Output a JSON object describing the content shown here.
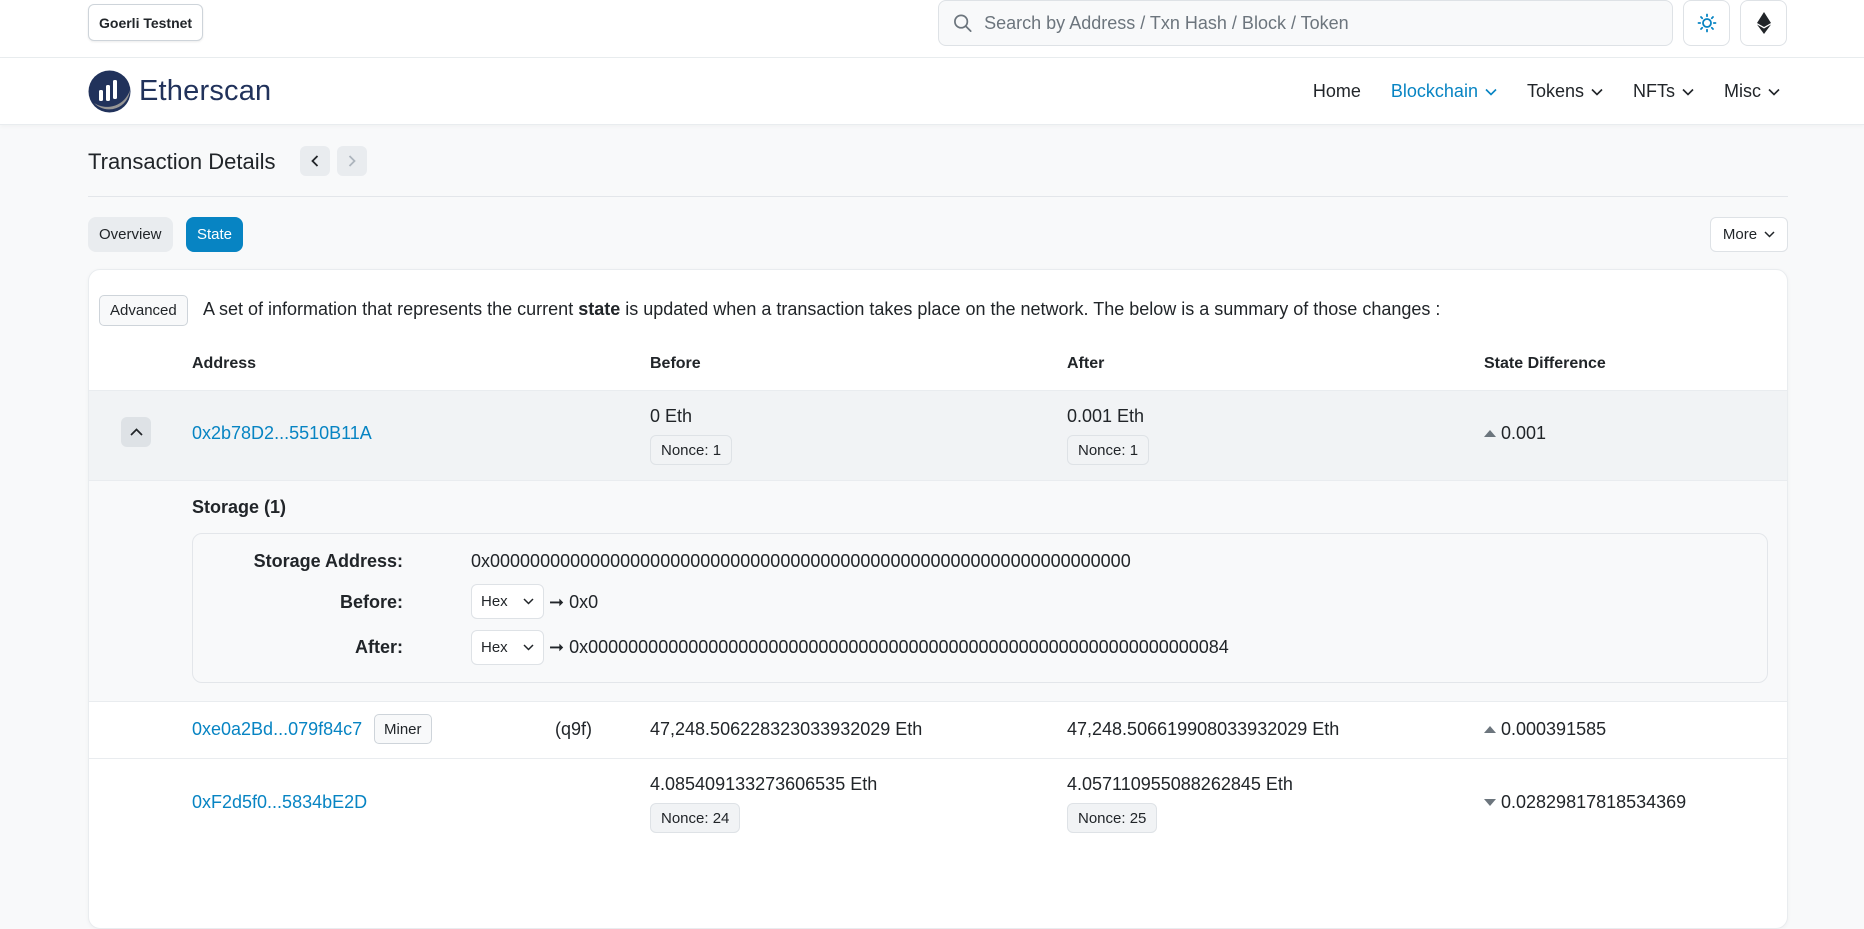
{
  "topbar": {
    "network": "Goerli Testnet",
    "search_placeholder": "Search by Address / Txn Hash / Block / Token"
  },
  "nav": {
    "logo_text": "Etherscan",
    "items": [
      {
        "label": "Home",
        "dropdown": false,
        "active": false
      },
      {
        "label": "Blockchain",
        "dropdown": true,
        "active": true
      },
      {
        "label": "Tokens",
        "dropdown": true,
        "active": false
      },
      {
        "label": "NFTs",
        "dropdown": true,
        "active": false
      },
      {
        "label": "Misc",
        "dropdown": true,
        "active": false
      }
    ]
  },
  "page": {
    "title": "Transaction Details",
    "tabs": [
      {
        "label": "Overview",
        "active": false
      },
      {
        "label": "State",
        "active": true
      }
    ],
    "more_label": "More"
  },
  "state": {
    "advanced_label": "Advanced",
    "intro_before": "A set of information that represents the current ",
    "intro_bold": "state",
    "intro_after": " is updated when a transaction takes place on the network. The below is a summary of those changes :",
    "columns": {
      "address": "Address",
      "before": "Before",
      "after": "After",
      "diff": "State Difference"
    },
    "rows": [
      {
        "address": "0x2b78D2...5510B11A",
        "before": "0 Eth",
        "before_nonce": "Nonce: 1",
        "after": "0.001 Eth",
        "after_nonce": "Nonce: 1",
        "diff": "0.001",
        "direction": "up"
      },
      {
        "address": "0xe0a2Bd...079f84c7",
        "badge": "Miner",
        "tag": "(q9f)",
        "before": "47,248.506228323033932029 Eth",
        "after": "47,248.506619908033932029 Eth",
        "diff": "0.000391585",
        "direction": "up"
      },
      {
        "address": "0xF2d5f0...5834bE2D",
        "before": "4.085409133273606535 Eth",
        "before_nonce": "Nonce: 24",
        "after": "4.057110955088262845 Eth",
        "after_nonce": "Nonce: 25",
        "diff": "0.02829817818534369",
        "direction": "down"
      }
    ],
    "storage": {
      "title": "Storage (1)",
      "address_label": "Storage Address:",
      "address_value": "0x0000000000000000000000000000000000000000000000000000000000000000",
      "before_label": "Before:",
      "before_format": "Hex",
      "before_value": "0x0",
      "after_label": "After:",
      "after_format": "Hex",
      "after_value": "0x0000000000000000000000000000000000000000000000000000000000000084",
      "arrow": "➞"
    }
  },
  "colors": {
    "accent": "#0784c3",
    "text": "#212529",
    "muted": "#6c757d"
  }
}
